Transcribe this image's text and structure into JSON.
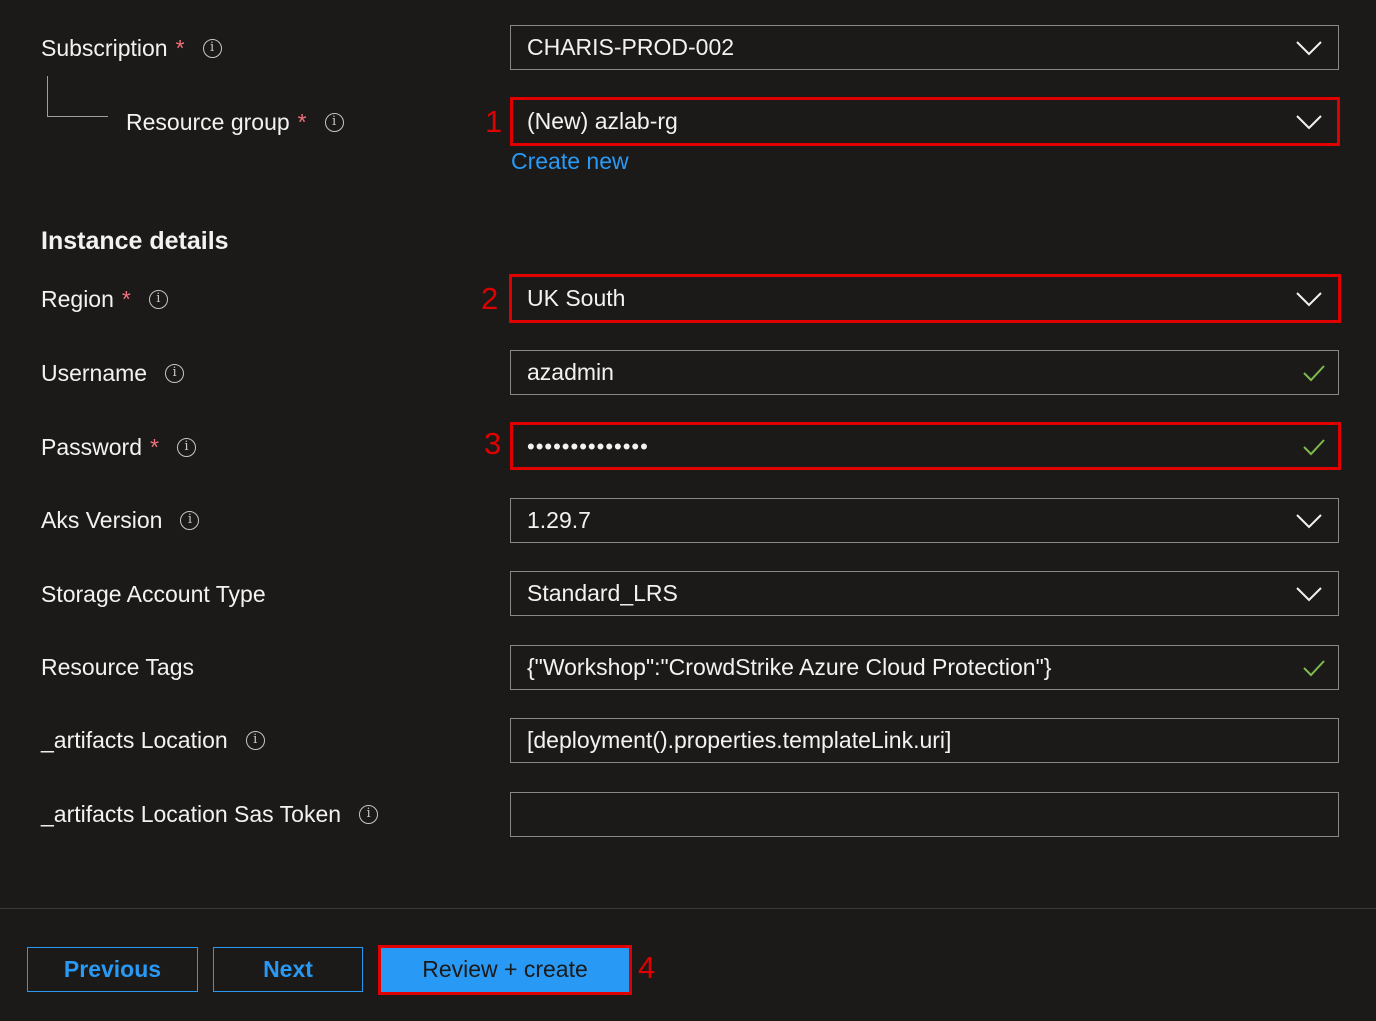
{
  "form": {
    "subscription": {
      "label": "Subscription",
      "required": "*",
      "value": "CHARIS-PROD-002"
    },
    "resource_group": {
      "label": "Resource group",
      "required": "*",
      "value": "(New) azlab-rg",
      "create_new": "Create new"
    },
    "instance_details_title": "Instance details",
    "region": {
      "label": "Region",
      "required": "*",
      "value": "UK South"
    },
    "username": {
      "label": "Username",
      "value": "azadmin"
    },
    "password": {
      "label": "Password",
      "required": "*",
      "value": "••••••••••••••"
    },
    "aks_version": {
      "label": "Aks Version",
      "value": "1.29.7"
    },
    "storage_account_type": {
      "label": "Storage Account Type",
      "value": "Standard_LRS"
    },
    "resource_tags": {
      "label": "Resource Tags",
      "value": "{\"Workshop\":\"CrowdStrike Azure Cloud Protection\"}"
    },
    "artifacts_location": {
      "label": "_artifacts Location",
      "value": "[deployment().properties.templateLink.uri]"
    },
    "artifacts_sas_token": {
      "label": "_artifacts Location Sas Token",
      "value": ""
    }
  },
  "info_glyph": "i",
  "annotations": {
    "n1": "1",
    "n2": "2",
    "n3": "3",
    "n4": "4"
  },
  "footer": {
    "previous": "Previous",
    "next": "Next",
    "review_create": "Review + create"
  },
  "colors": {
    "background": "#1b1a19",
    "accent": "#2899f5",
    "required": "#f1707b",
    "highlight": "#e00000",
    "valid_check": "#7fba4d"
  },
  "icons": {
    "dropdown": "chevron-down-icon",
    "valid": "checkmark-icon",
    "info": "info-icon"
  }
}
